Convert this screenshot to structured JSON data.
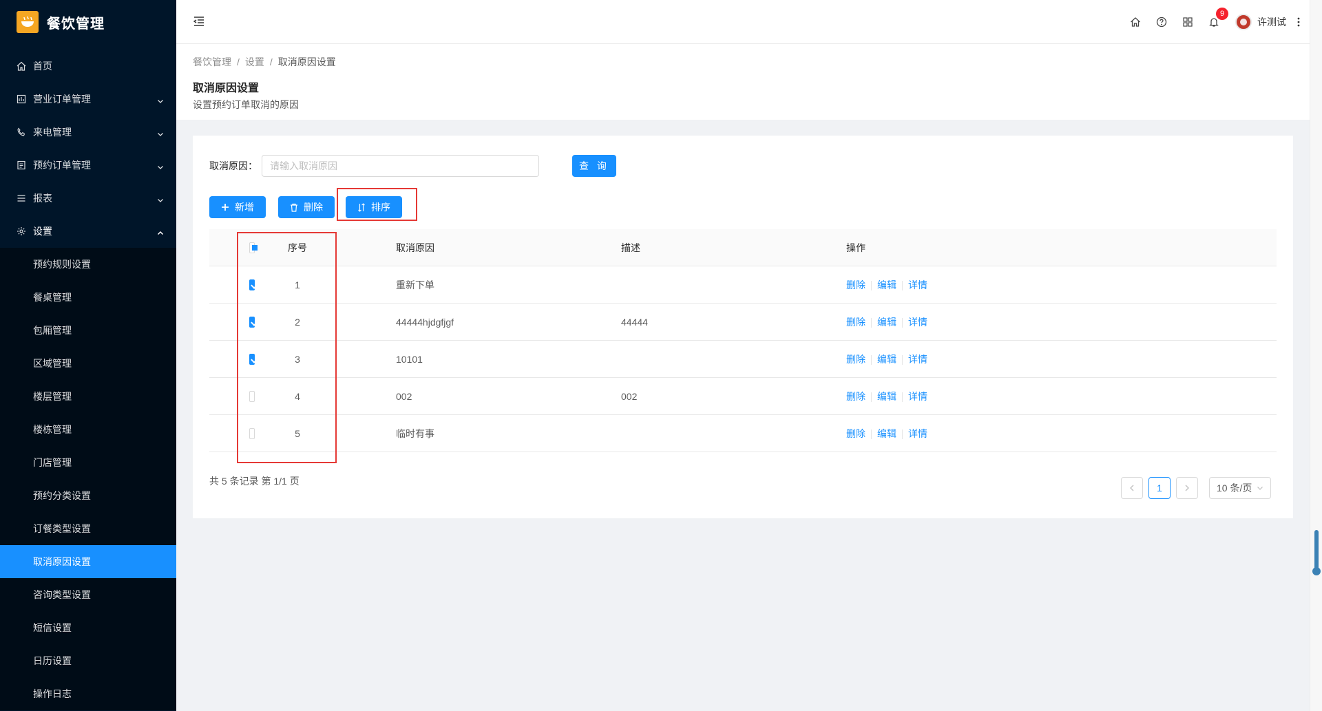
{
  "app": {
    "title": "餐饮管理"
  },
  "sidebar": {
    "items": [
      {
        "label": "首页",
        "icon": "home-icon",
        "has_arrow": false
      },
      {
        "label": "营业订单管理",
        "icon": "order-icon",
        "has_arrow": true
      },
      {
        "label": "来电管理",
        "icon": "phone-icon",
        "has_arrow": true
      },
      {
        "label": "预约订单管理",
        "icon": "reservation-icon",
        "has_arrow": true
      },
      {
        "label": "报表",
        "icon": "report-icon",
        "has_arrow": true
      },
      {
        "label": "设置",
        "icon": "gear-icon",
        "has_arrow": true,
        "open": true
      }
    ],
    "settings_submenu": [
      "预约规则设置",
      "餐桌管理",
      "包厢管理",
      "区域管理",
      "楼层管理",
      "楼栋管理",
      "门店管理",
      "预约分类设置",
      "订餐类型设置",
      "取消原因设置",
      "咨询类型设置",
      "短信设置",
      "日历设置",
      "操作日志"
    ],
    "active_submenu": "取消原因设置"
  },
  "header": {
    "notification_count": "9",
    "user_name": "许测试"
  },
  "breadcrumb": {
    "items": [
      "餐饮管理",
      "设置",
      "取消原因设置"
    ]
  },
  "page": {
    "title": "取消原因设置",
    "description": "设置预约订单取消的原因"
  },
  "search": {
    "label": "取消原因：",
    "placeholder": "请输入取消原因",
    "value": "",
    "query_button": "查 询"
  },
  "toolbar": {
    "add_label": "新增",
    "delete_label": "删除",
    "sort_label": "排序"
  },
  "table": {
    "columns": {
      "index": "序号",
      "reason": "取消原因",
      "desc": "描述",
      "ops": "操作"
    },
    "header_checkbox": "indeterminate",
    "rows": [
      {
        "index": "1",
        "reason": "重新下单",
        "desc": "",
        "checked": true
      },
      {
        "index": "2",
        "reason": "44444hjdgfjgf",
        "desc": "44444",
        "checked": true
      },
      {
        "index": "3",
        "reason": "10101",
        "desc": "",
        "checked": true
      },
      {
        "index": "4",
        "reason": "002",
        "desc": "002",
        "checked": false
      },
      {
        "index": "5",
        "reason": "临时有事",
        "desc": "",
        "checked": false
      }
    ],
    "ops": {
      "delete": "删除",
      "edit": "编辑",
      "detail": "详情"
    }
  },
  "footer": {
    "total_text": "共 5 条记录 第 1/1 页",
    "current_page": "1",
    "page_size": "10 条/页"
  },
  "colors": {
    "sidebar_bg": "#001529",
    "accent": "#1890ff",
    "highlight_box": "#e53935",
    "logo_bg": "#f5a623"
  }
}
